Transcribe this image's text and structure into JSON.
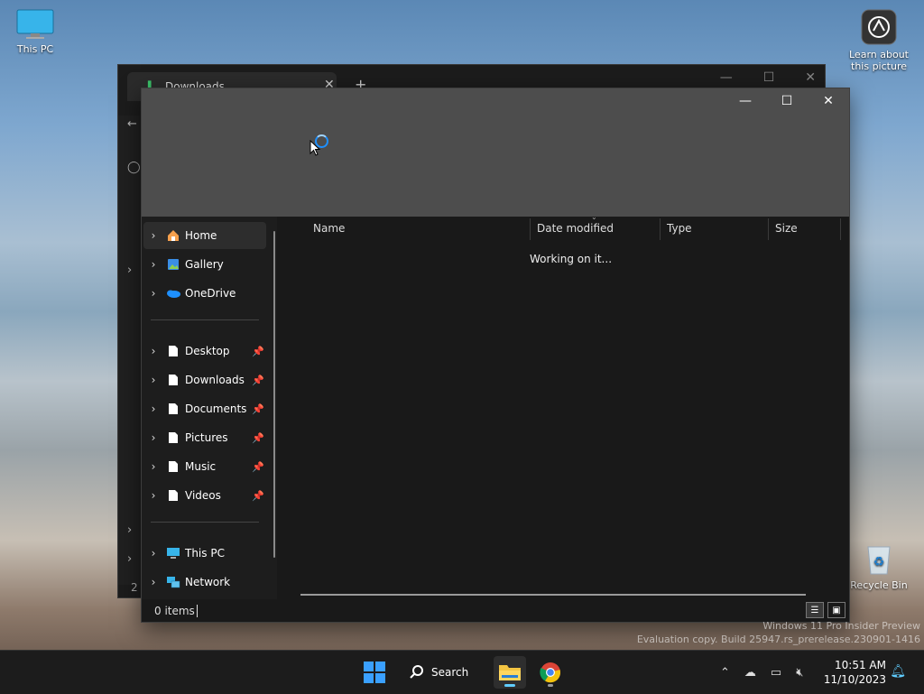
{
  "desktop": {
    "this_pc_label": "This PC",
    "learn_label_line1": "Learn about",
    "learn_label_line2": "this picture",
    "recycle_label": "Recycle Bin"
  },
  "background_window": {
    "tab_title": "Downloads",
    "status_text": "2 i"
  },
  "window": {
    "caption": {
      "minimize": "—",
      "maximize": "☐",
      "close": "✕"
    },
    "nav": [
      {
        "label": "Home",
        "icon": "home-icon",
        "selected": true
      },
      {
        "label": "Gallery",
        "icon": "gallery-icon"
      },
      {
        "label": "OneDrive",
        "icon": "onedrive-icon"
      },
      {
        "label": "Desktop",
        "icon": "file-icon",
        "pinned": true
      },
      {
        "label": "Downloads",
        "icon": "file-icon",
        "pinned": true
      },
      {
        "label": "Documents",
        "icon": "file-icon",
        "pinned": true
      },
      {
        "label": "Pictures",
        "icon": "file-icon",
        "pinned": true
      },
      {
        "label": "Music",
        "icon": "file-icon",
        "pinned": true
      },
      {
        "label": "Videos",
        "icon": "file-icon",
        "pinned": true
      },
      {
        "label": "This PC",
        "icon": "pc-icon"
      },
      {
        "label": "Network",
        "icon": "network-icon"
      }
    ],
    "columns": {
      "name": "Name",
      "date": "Date modified",
      "type": "Type",
      "size": "Size"
    },
    "working_text": "Working on it...",
    "status_count": "0 items"
  },
  "watermark": {
    "line1": "Windows 11 Pro Insider Preview",
    "line2": "Evaluation copy. Build 25947.rs_prerelease.230901-1416"
  },
  "taskbar": {
    "search_label": "Search",
    "time": "10:51 AM",
    "date": "11/10/2023"
  },
  "colors": {
    "accent": "#60cdff",
    "start_blue": "#3aa0ff",
    "title_gray": "#4d4d4d"
  }
}
